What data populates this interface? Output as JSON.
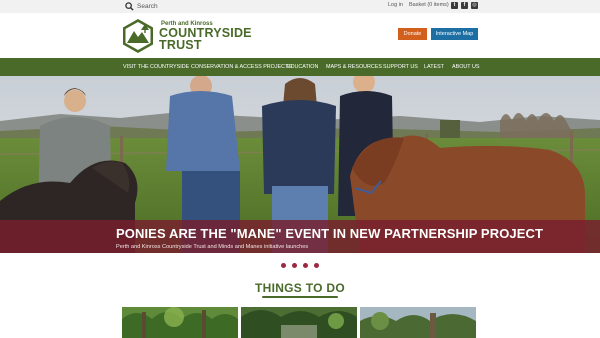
{
  "utility": {
    "search_placeholder": "Search",
    "login": "Log in",
    "basket": "Basket (0 items)",
    "social_icons": [
      "twitter-icon",
      "facebook-icon",
      "instagram-icon"
    ]
  },
  "brand": {
    "small_name": "Perth and Kinross",
    "big_line1": "COUNTRYSIDE",
    "big_line2": "TRUST",
    "color": "#4a6a2a"
  },
  "header": {
    "donate": "Donate",
    "interactive_map": "Interactive Map",
    "donate_color": "#d35f1c",
    "map_color": "#1d6fa3"
  },
  "nav": {
    "items": [
      "VISIT THE COUNTRYSIDE",
      "CONSERVATION & ACCESS PROJECTS",
      "EDUCATION",
      "MAPS & RESOURCES",
      "SUPPORT US",
      "LATEST",
      "ABOUT US"
    ]
  },
  "hero": {
    "title": "PONIES ARE THE \"MANE\" EVENT IN NEW PARTNERSHIP PROJECT",
    "subtitle": "Perth and Kinross Countryside Trust and Minds and Manes initiative launches",
    "slide_count": 4,
    "band_color": "#9b2a3e"
  },
  "things": {
    "title": "THINGS TO DO"
  }
}
